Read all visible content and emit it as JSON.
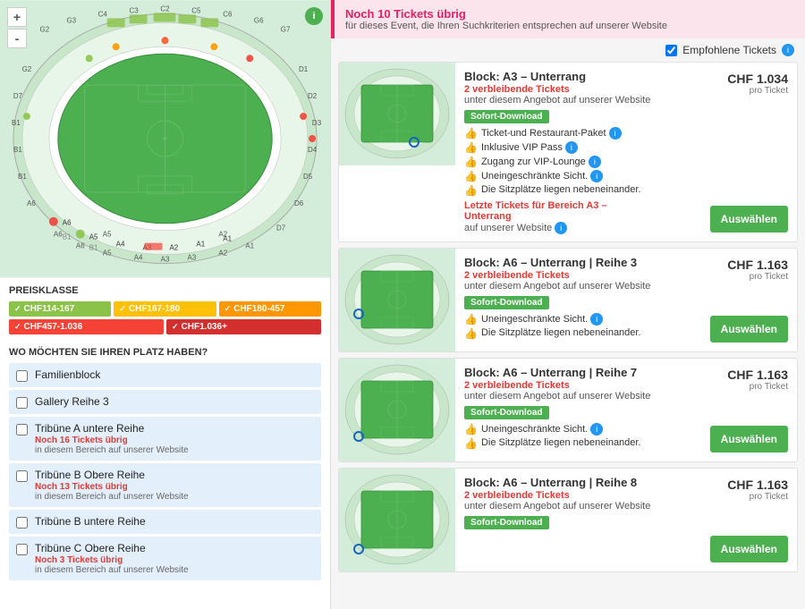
{
  "left": {
    "map_info_icon": "i",
    "zoom_in": "+",
    "zoom_out": "-",
    "preisklasse_title": "PREISKLASSE",
    "prices": [
      {
        "label": "CHF114-167",
        "class": "price-green"
      },
      {
        "label": "CHF167-180",
        "class": "price-yellow"
      },
      {
        "label": "CHF180-457",
        "class": "price-orange"
      },
      {
        "label": "CHF457-1.036",
        "class": "price-red"
      },
      {
        "label": "CHF1.036+",
        "class": "price-dark-red"
      }
    ],
    "wo_title": "WO MÖCHTEN SIE IHREN PLATZ HABEN?",
    "wo_items": [
      {
        "label": "Familienblock",
        "sub": "",
        "sub_count": ""
      },
      {
        "label": "Gallery Reihe 3",
        "sub": "",
        "sub_count": ""
      },
      {
        "label": "Tribüne A untere Reihe",
        "sub": "in diesem Bereich auf unserer Website",
        "sub_count": "Noch 16 Tickets übrig"
      },
      {
        "label": "Tribüne B Obere Reihe",
        "sub": "in diesem Bereich auf unserer Website",
        "sub_count": "Noch 13 Tickets übrig"
      },
      {
        "label": "Tribüne B untere Reihe",
        "sub": "",
        "sub_count": ""
      },
      {
        "label": "Tribüne C Obere Reihe",
        "sub": "in diesem Bereich auf unserer Website",
        "sub_count": "Noch 3 Tickets übrig"
      }
    ]
  },
  "right": {
    "alert_title": "Noch 10 Tickets übrig",
    "alert_sub": "für dieses Event, die Ihren Suchkriterien entsprechen auf unserer Website",
    "filter_label": "Empfohlene Tickets",
    "tickets": [
      {
        "block": "Block: A3 – Unterrang",
        "remaining": "2 verbleibende Tickets",
        "source": "unter diesem Angebot auf unserer Website",
        "sofort": "Sofort-Download",
        "features": [
          "Ticket-und Restaurant-Paket",
          "Inklusive VIP Pass",
          "Zugang zur VIP-Lounge",
          "Uneingeschränkte Sicht.",
          "Die Sitzplätze liegen nebeneinander."
        ],
        "warning": "Letzte Tickets für Bereich A3 – Unterrang",
        "warning2": "auf unserer Website",
        "price": "CHF 1.034",
        "price_label": "pro Ticket",
        "btn": "Auswählen",
        "dot_x": "62%",
        "dot_y": "72%"
      },
      {
        "block": "Block: A6 – Unterrang | Reihe 3",
        "remaining": "2 verbleibende Tickets",
        "source": "unter diesem Angebot auf unserer Website",
        "sofort": "Sofort-Download",
        "features": [
          "Uneingeschränkte Sicht.",
          "Die Sitzplätze liegen nebeneinander."
        ],
        "warning": "",
        "warning2": "",
        "price": "CHF 1.163",
        "price_label": "pro Ticket",
        "btn": "Auswählen",
        "dot_x": "14%",
        "dot_y": "60%"
      },
      {
        "block": "Block: A6 – Unterrang | Reihe 7",
        "remaining": "2 verbleibende Tickets",
        "source": "unter diesem Angebot auf unserer Website",
        "sofort": "Sofort-Download",
        "features": [
          "Uneingeschränkte Sicht.",
          "Die Sitzplätze liegen nebeneinander."
        ],
        "warning": "",
        "warning2": "",
        "price": "CHF 1.163",
        "price_label": "pro Ticket",
        "btn": "Auswählen",
        "dot_x": "14%",
        "dot_y": "72%"
      },
      {
        "block": "Block: A6 – Unterrang | Reihe 8",
        "remaining": "2 verbleibende Tickets",
        "source": "unter diesem Angebot auf unserer Website",
        "sofort": "Sofort-Download",
        "features": [],
        "warning": "",
        "warning2": "",
        "price": "CHF 1.163",
        "price_label": "pro Ticket",
        "btn": "Auswählen",
        "dot_x": "14%",
        "dot_y": "75%"
      }
    ]
  }
}
